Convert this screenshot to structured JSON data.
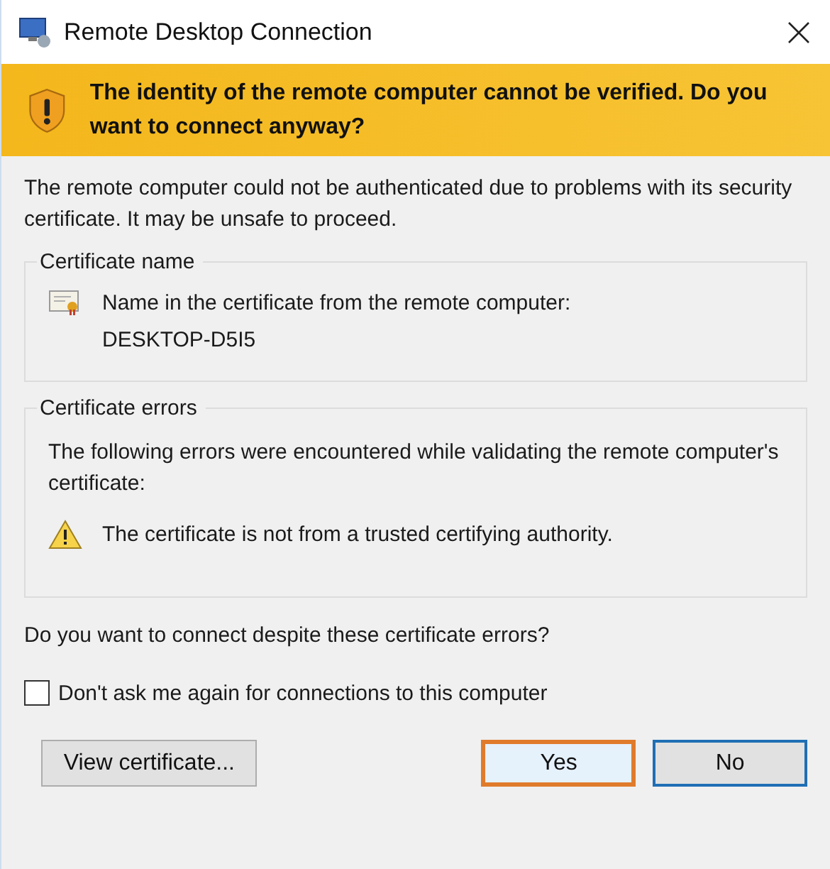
{
  "window": {
    "title": "Remote Desktop Connection"
  },
  "banner": {
    "text": "The identity of the remote computer cannot be verified. Do you want to connect anyway?"
  },
  "message": "The remote computer could not be authenticated due to problems with its security certificate. It may be unsafe to proceed.",
  "certificate_name": {
    "title": "Certificate name",
    "label": "Name in the certificate from the remote computer:",
    "value": "DESKTOP-D5I5"
  },
  "certificate_errors": {
    "title": "Certificate errors",
    "intro": "The following errors were encountered while validating the remote computer's certificate:",
    "errors": [
      "The certificate is not from a trusted certifying authority."
    ]
  },
  "question": "Do you want to connect despite these certificate errors?",
  "dont_ask": {
    "label": "Don't ask me again for connections to this computer",
    "checked": false
  },
  "buttons": [
    {
      "label": "View certificate...",
      "focused": false,
      "default": false
    },
    {
      "label": "Yes",
      "focused": true,
      "default": false
    },
    {
      "label": "No",
      "focused": false,
      "default": true
    }
  ]
}
